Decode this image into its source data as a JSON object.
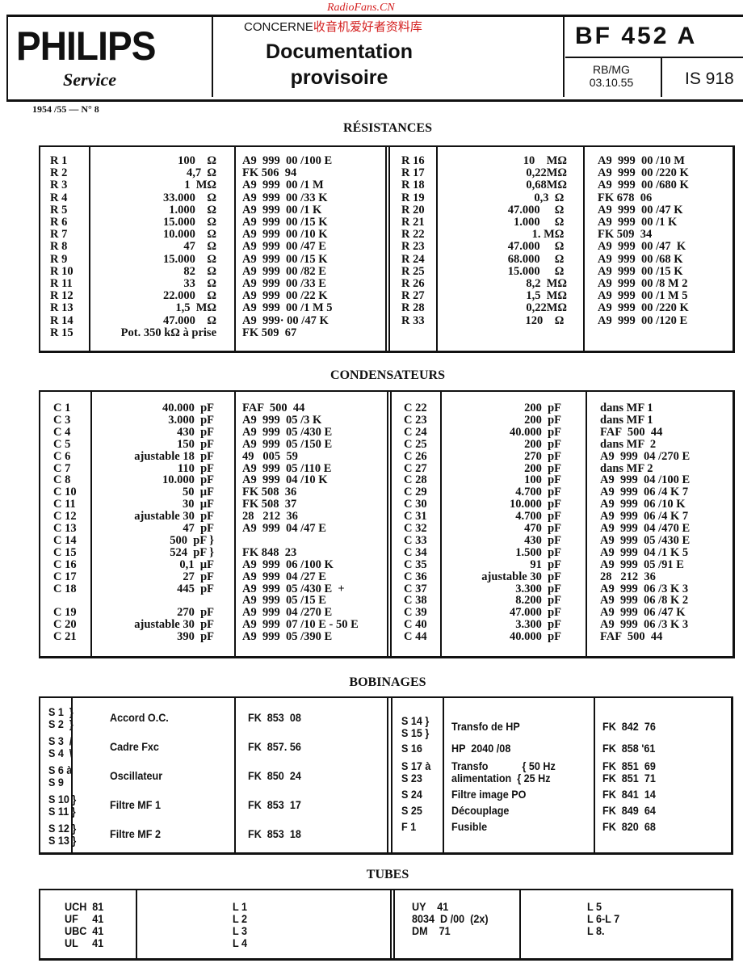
{
  "watermark": "RadioFans.CN",
  "header": {
    "brand": "PHILIPS",
    "service": "Service",
    "concerne": "CONCERNE",
    "concerne_cn": "收音机爱好者资料库",
    "doc_line1": "Documentation",
    "doc_line2": "provisoire",
    "model": "BF 452 A",
    "ref_initials": "RB/MG",
    "ref_date": "03.10.55",
    "is_number": "IS 918",
    "issue": "1954 /55 — N° 8"
  },
  "resistances": {
    "title": "RÉSISTANCES",
    "left": [
      [
        "R 1",
        "100    Ω",
        "A9  999  00 /100 E"
      ],
      [
        "R 2",
        "4,7  Ω",
        "FK 506  94"
      ],
      [
        "R 3",
        "1  MΩ",
        "A9  999  00 /1 M"
      ],
      [
        "R 4",
        "33.000    Ω",
        "A9  999  00 /33 K"
      ],
      [
        "R 5",
        "1.000    Ω",
        "A9  999  00 /1 K"
      ],
      [
        "R 6",
        "15.000    Ω",
        "A9  999  00 /15 K"
      ],
      [
        "R 7",
        "10.000    Ω",
        "A9  999  00 /10 K"
      ],
      [
        "R 8",
        "47    Ω",
        "A9  999  00 /47 E"
      ],
      [
        "R 9",
        "15.000    Ω",
        "A9  999  00 /15 K"
      ],
      [
        "R 10",
        "82    Ω",
        "A9  999  00 /82 E"
      ],
      [
        "R 11",
        "33    Ω",
        "A9  999  00 /33 E"
      ],
      [
        "R 12",
        "22.000    Ω",
        "A9  999  00 /22 K"
      ],
      [
        "R 13",
        "1,5  MΩ",
        "A9  999  00 /1 M 5"
      ],
      [
        "R 14",
        "47.000    Ω",
        "A9  999· 00 /47 K"
      ],
      [
        "R 15",
        "Pot. 350 kΩ à prise",
        "FK 509  67"
      ]
    ],
    "right": [
      [
        "R 16",
        "10    MΩ",
        "A9  999  00 /10 M"
      ],
      [
        "R 17",
        "0,22MΩ",
        "A9  999  00 /220 K"
      ],
      [
        "R 18",
        "0,68MΩ",
        "A9  999  00 /680 K"
      ],
      [
        "R 19",
        "0,3  Ω ",
        "FK 678  06"
      ],
      [
        "R 20",
        "47.000     Ω ",
        "A9  999  00 /47 K"
      ],
      [
        "R 21",
        "1.000     Ω ",
        "A9  999  00 /1 K"
      ],
      [
        "R 22",
        "1. MΩ ",
        "FK 509  34"
      ],
      [
        "R 23",
        "47.000     Ω ",
        "A9  999  00 /47  K"
      ],
      [
        "R 24",
        "68.000     Ω ",
        "A9  999  00 /68 K"
      ],
      [
        "R 25",
        "15.000     Ω ",
        "A9  999  00 /15 K"
      ],
      [
        "R 26",
        "8,2  MΩ",
        "A9  999  00 /8 M 2"
      ],
      [
        "R 27",
        "1,5  MΩ",
        "A9  999  00 /1 M 5"
      ],
      [
        "R 28",
        "0,22MΩ",
        "A9  999  00 /220 K"
      ],
      [
        "R 33",
        "120    Ω ",
        "A9  999  00 /120 E"
      ]
    ]
  },
  "condensateurs": {
    "title": "CONDENSATEURS",
    "left": [
      [
        "C 1",
        "40.000  pF",
        "FAF  500  44"
      ],
      [
        "C 3",
        "3.000  pF",
        "A9  999  05 /3 K"
      ],
      [
        "C 4",
        "430  pF",
        "A9  999  05 /430 E"
      ],
      [
        "C 5",
        "150  pF",
        "A9  999  05 /150 E"
      ],
      [
        "C 6",
        "ajustable 18  pF",
        "49   005  59"
      ],
      [
        "C 7",
        "110  pF",
        "A9  999  05 /110 E"
      ],
      [
        "C 8",
        "10.000  pF",
        "A9  999  04 /10 K"
      ],
      [
        "C 10",
        "50  µF",
        "FK 508  36"
      ],
      [
        "C 11",
        "30  µF",
        "FK 508  37"
      ],
      [
        "C 12",
        "ajustable 30  pF",
        "28   212  36"
      ],
      [
        "C 13",
        "47  pF",
        "A9  999  04 /47 E"
      ],
      [
        "C 14",
        "500  pF }",
        ""
      ],
      [
        "C 15",
        "524  pF }",
        "FK 848  23"
      ],
      [
        "C 16",
        "0,1  µF",
        "A9  999  06 /100 K"
      ],
      [
        "C 17",
        "27  pF",
        "A9  999  04 /27 E"
      ],
      [
        "C 18",
        "445  pF",
        "A9  999  05 /430 E  +"
      ],
      [
        "",
        "",
        "A9  999  05 /15 E"
      ],
      [
        "C 19",
        "270  pF",
        "A9  999  04 /270 E"
      ],
      [
        "C 20",
        "ajustable 30  pF",
        "A9  999  07 /10 E - 50 E"
      ],
      [
        "C 21",
        "390  pF",
        "A9  999  05 /390 E"
      ]
    ],
    "right": [
      [
        "C 22",
        "200  pF",
        "dans MF 1"
      ],
      [
        "C 23",
        "200  pF",
        "dans MF 1"
      ],
      [
        "C 24",
        "40.000  pF",
        "FAF  500  44"
      ],
      [
        "C 25",
        "200  pF",
        "dans MF  2"
      ],
      [
        "C 26",
        "270  pF",
        "A9  999  04 /270 E"
      ],
      [
        "C 27",
        "200  pF",
        "dans MF 2"
      ],
      [
        "C 28",
        "100  pF",
        "A9  999  04 /100 E"
      ],
      [
        "C 29",
        "4.700  pF",
        "A9  999  06 /4 K 7"
      ],
      [
        "C 30",
        "10.000  pF",
        "A9  999  06 /10 K"
      ],
      [
        "C 31",
        "4.700  pF",
        "A9  999  06 /4 K 7"
      ],
      [
        "C 32",
        "470  pF",
        "A9  999  04 /470 E"
      ],
      [
        "C 33",
        "430  pF",
        "A9  999  05 /430 E"
      ],
      [
        "C 34",
        "1.500  pF",
        "A9  999  04 /1 K 5"
      ],
      [
        "C 35",
        "91  pF",
        "A9  999  05 /91 E"
      ],
      [
        "C 36",
        "ajustable 30  pF",
        "28   212  36"
      ],
      [
        "C 37",
        "3.300  pF",
        "A9  999  06 /3 K 3"
      ],
      [
        "C 38",
        "8.200  pF",
        "A9  999  06 /8 K 2"
      ],
      [
        "C 39",
        "47.000  pF",
        "A9  999  06 /47 K"
      ],
      [
        "C 40",
        "3.300  pF",
        "A9  999  06 /3 K 3"
      ],
      [
        "C 44",
        "40.000  pF",
        "FAF  500  44"
      ]
    ]
  },
  "bobinages": {
    "title": "BOBINAGES",
    "left": [
      [
        "S 1  }\nS 2  }",
        "Accord O.C.",
        "FK  853  08"
      ],
      [
        "S 3  /\nS 4  \\",
        "Cadre Fxc",
        "FK  857. 56"
      ],
      [
        "S 6 à\nS 9",
        "Oscillateur",
        "FK  850  24"
      ],
      [
        "S 10 }\nS 11 }",
        "Filtre MF 1",
        "FK  853  17"
      ],
      [
        "S 12 }\nS 13 }",
        "Filtre MF 2",
        "FK  853  18"
      ]
    ],
    "right": [
      [
        "S 14 }\nS 15 }",
        "Transfo de HP",
        "FK  842  76"
      ],
      [
        "S 16",
        "HP  2040 /08",
        "FK  858 '61"
      ],
      [
        "S 17 à\nS 23",
        "Transfo            { 50 Hz\nalimentation  { 25 Hz",
        "FK  851  69\nFK  851  71"
      ],
      [
        "S 24",
        "Filtre image PO",
        "FK  841  14"
      ],
      [
        "S 25",
        "Découplage",
        "FK  849  64"
      ],
      [
        "F 1",
        "Fusible",
        "FK  820  68"
      ]
    ]
  },
  "tubes": {
    "title": "TUBES",
    "left_types": "UCH  81\nUF     41\nUBC  41\nUL     41",
    "left_refs": "L 1\nL 2\nL 3\nL 4",
    "right_types": "UY    41\n8034  D /00  (2x)\nDM    71",
    "right_refs": "L 5\nL 6-L 7\nL 8."
  }
}
